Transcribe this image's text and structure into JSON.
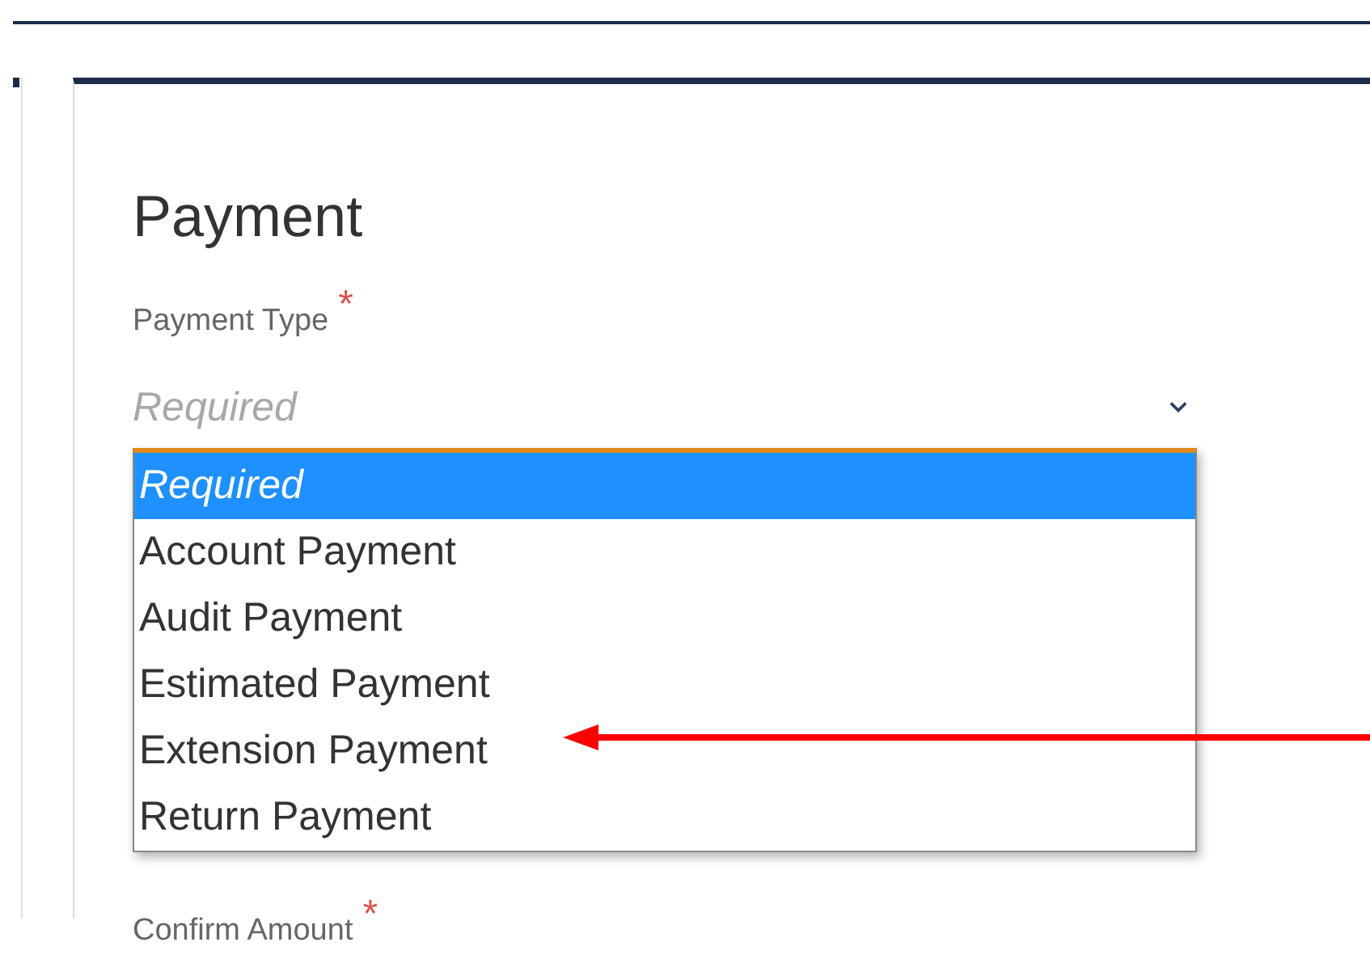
{
  "form": {
    "title": "Payment",
    "payment_type": {
      "label": "Payment Type",
      "required_mark": "*",
      "placeholder": "Required",
      "expanded": true,
      "options": [
        {
          "label": "Required",
          "selected": true,
          "placeholder": true
        },
        {
          "label": "Account Payment",
          "selected": false,
          "placeholder": false
        },
        {
          "label": "Audit Payment",
          "selected": false,
          "placeholder": false
        },
        {
          "label": "Estimated Payment",
          "selected": false,
          "placeholder": false
        },
        {
          "label": "Extension Payment",
          "selected": false,
          "placeholder": false
        },
        {
          "label": "Return Payment",
          "selected": false,
          "placeholder": false
        }
      ]
    },
    "confirm_amount": {
      "label": "Confirm Amount",
      "required_mark": "*"
    }
  }
}
